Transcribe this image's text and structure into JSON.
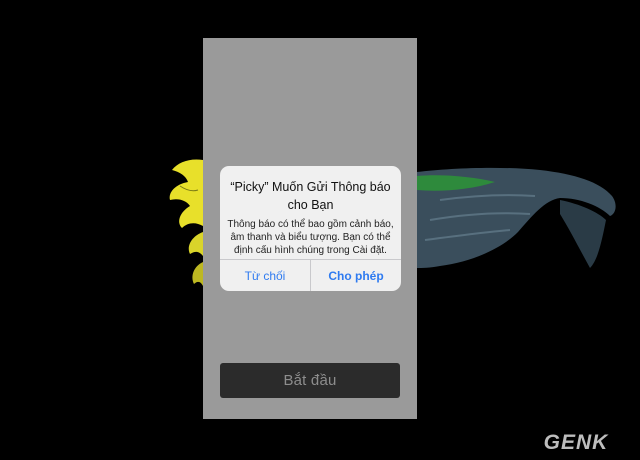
{
  "alert": {
    "title": "“Picky” Muốn Gửi Thông báo cho Bạn",
    "message": "Thông báo có thể bao gồm cảnh báo, âm thanh và biểu tượng. Bạn có thể định cấu hình chúng trong Cài đặt.",
    "deny_label": "Từ chối",
    "allow_label": "Cho phép"
  },
  "screen": {
    "start_label": "Bắt đầu"
  },
  "watermark": {
    "text": "GENK"
  },
  "colors": {
    "background": "#000000",
    "screen_overlay": "#9a9a9a",
    "alert_bg": "#f0f0f0",
    "action_blue": "#2f7bf0",
    "start_button_bg": "#2b2b2b"
  }
}
